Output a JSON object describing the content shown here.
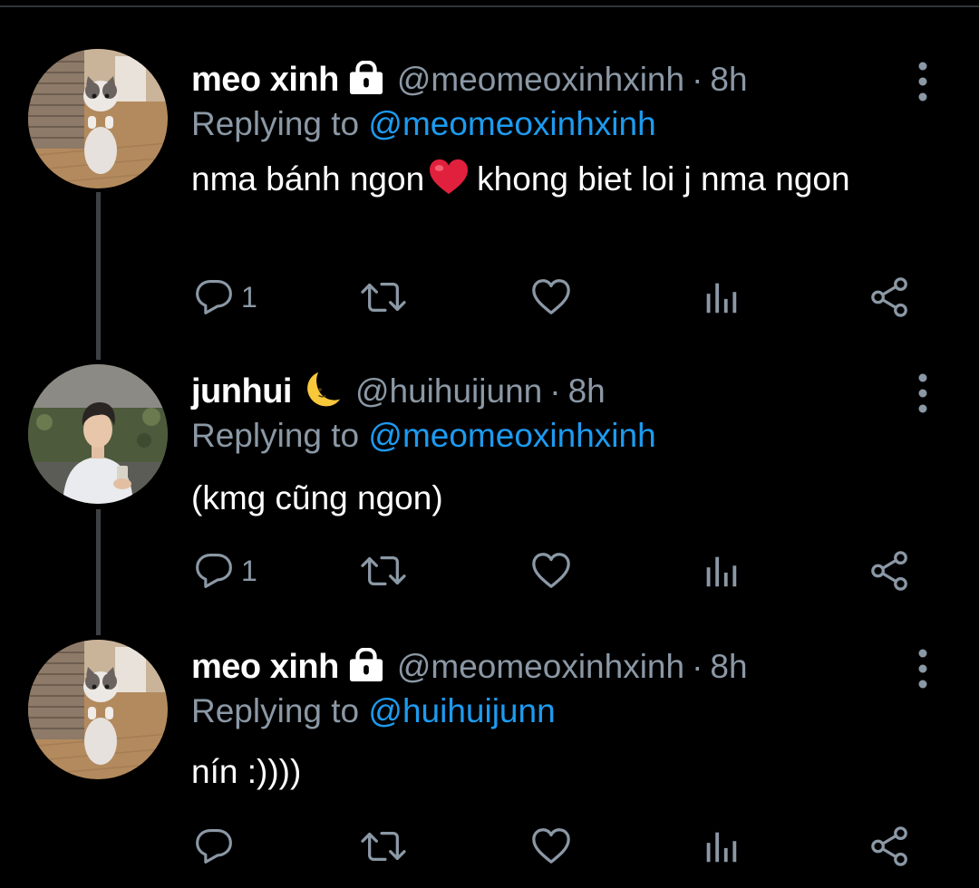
{
  "colors": {
    "background": "#000000",
    "text": "#ffffff",
    "muted": "#8b98a5",
    "link": "#1d9bf0",
    "thread_line": "#3e4144"
  },
  "tweets": [
    {
      "display_name": "meo xinh",
      "badge_icon": "lock-icon",
      "handle": "@meomeoxinhxinh",
      "separator": "·",
      "time": "8h",
      "replying_prefix": "Replying to",
      "replying_to": "@meomeoxinhxinh",
      "text_before_emoji": "nma bánh ngon",
      "emoji": "heart-emoji",
      "text_after_emoji": "khong biet loi j nma ngon",
      "reply_count": "1"
    },
    {
      "display_name": "junhui",
      "badge_icon": "crescent-moon-emoji",
      "handle": "@huihuijunn",
      "separator": "·",
      "time": "8h",
      "replying_prefix": "Replying to",
      "replying_to": "@meomeoxinhxinh",
      "text": "(kmg cũng ngon)",
      "reply_count": "1"
    },
    {
      "display_name": "meo xinh",
      "badge_icon": "lock-icon",
      "handle": "@meomeoxinhxinh",
      "separator": "·",
      "time": "8h",
      "replying_prefix": "Replying to",
      "replying_to": "@huihuijunn",
      "text": "nín :))))",
      "reply_count": ""
    }
  ],
  "action_icons": [
    "reply-icon",
    "retweet-icon",
    "like-icon",
    "analytics-icon",
    "share-icon"
  ]
}
